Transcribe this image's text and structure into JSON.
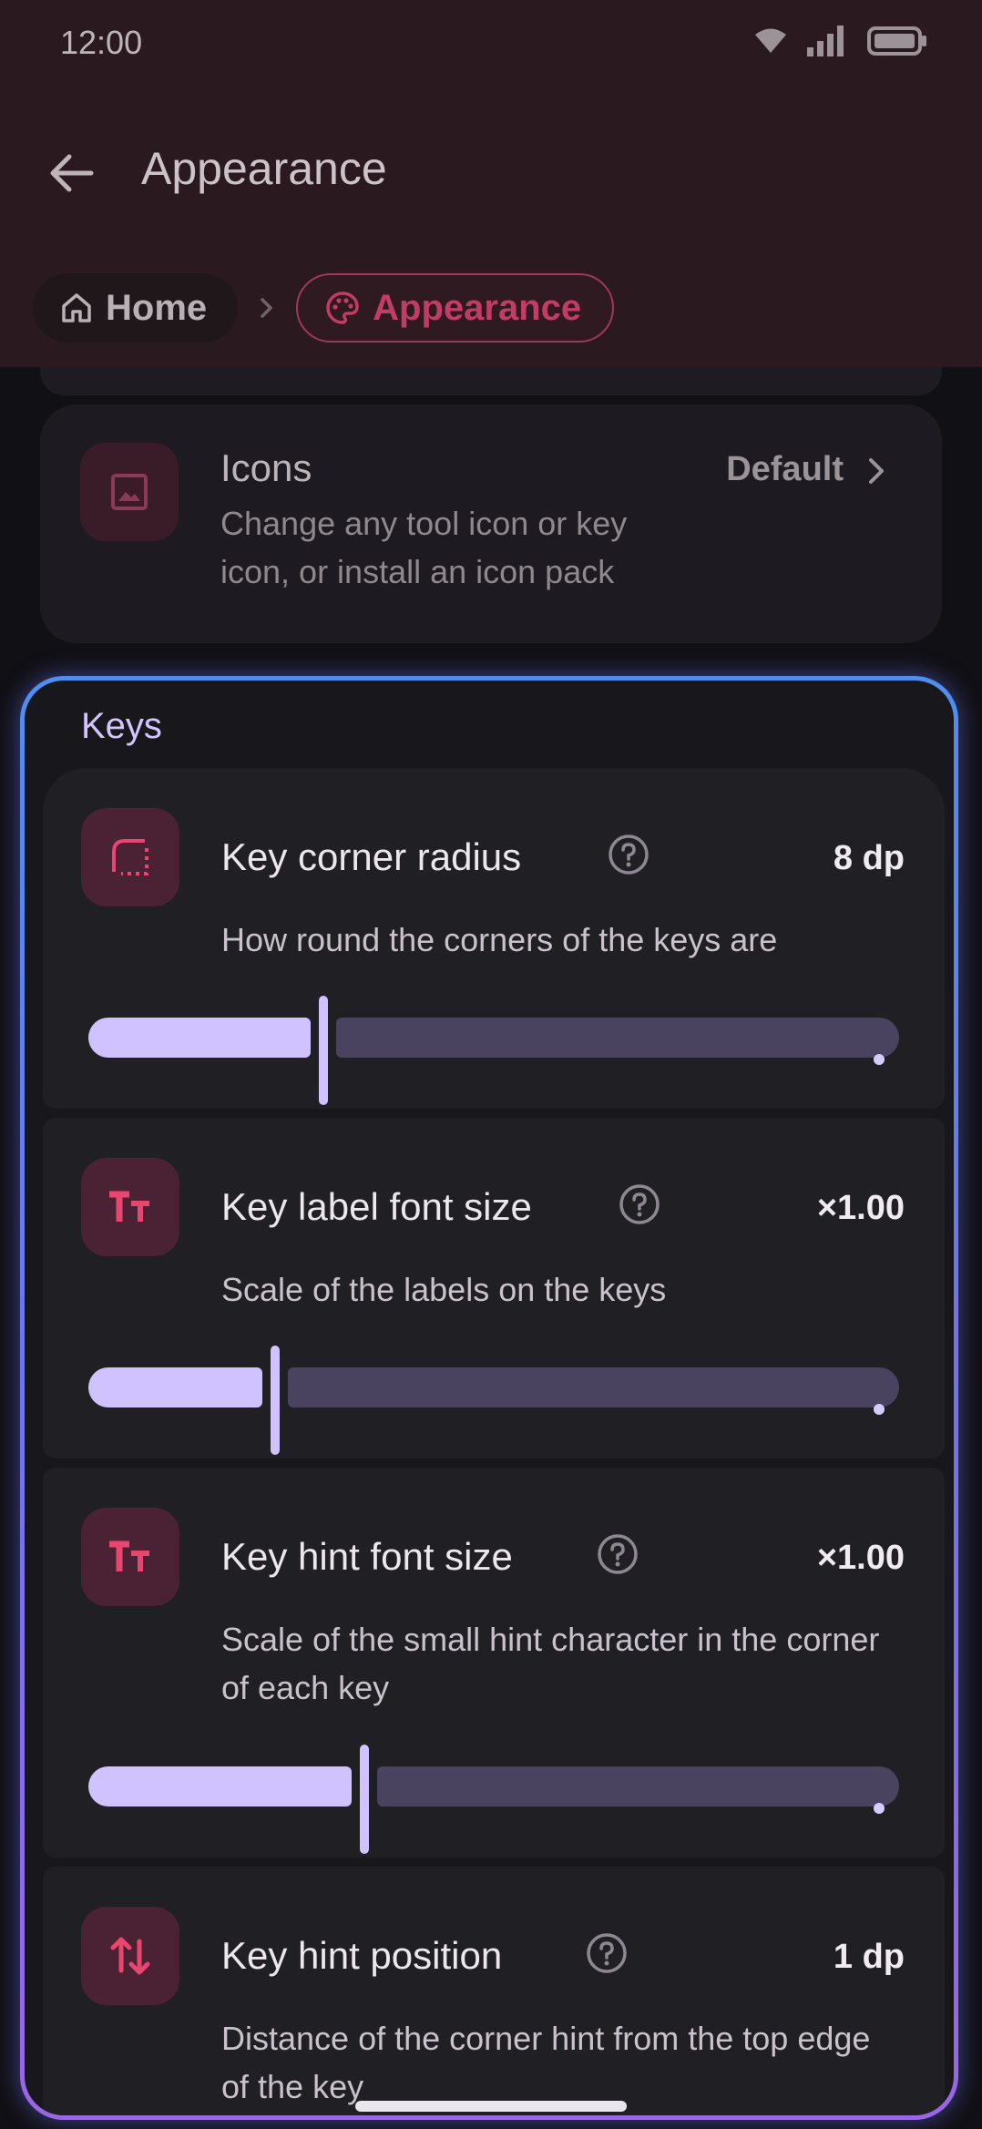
{
  "status_bar": {
    "time": "12:00"
  },
  "app_bar": {
    "title": "Appearance"
  },
  "breadcrumb": {
    "home_label": "Home",
    "current_label": "Appearance"
  },
  "icons_row": {
    "title": "Icons",
    "description": "Change any tool icon or key icon, or install an icon pack",
    "value": "Default"
  },
  "keys_section": {
    "label": "Keys",
    "items": [
      {
        "title": "Key corner radius",
        "description": "How round the corners of the keys are",
        "value": "8 dp",
        "slider_fraction": 0.29
      },
      {
        "title": "Key label font size",
        "description": "Scale of the labels on the keys",
        "value": "×1.00",
        "slider_fraction": 0.23
      },
      {
        "title": "Key hint font size",
        "description": "Scale of the small hint character in the corner of each key",
        "value": "×1.00",
        "slider_fraction": 0.34
      },
      {
        "title": "Key hint position",
        "description": "Distance of the corner hint from the top edge of the key",
        "value": "1 dp"
      }
    ]
  },
  "colors": {
    "accent": "#cfc2ff",
    "icon_accent": "#e8466f",
    "header_bg": "#2a1a20",
    "breadcrumb_active": "#c23d66"
  },
  "icons": {
    "back": "arrow-left-icon",
    "home": "home-icon",
    "palette": "palette-icon",
    "image": "image-icon",
    "corner_radius": "rounded-corner-icon",
    "font_size": "text-size-icon",
    "hint_position": "swap-vertical-icon",
    "help": "help-circle-icon",
    "chevron": "chevron-right-icon"
  }
}
